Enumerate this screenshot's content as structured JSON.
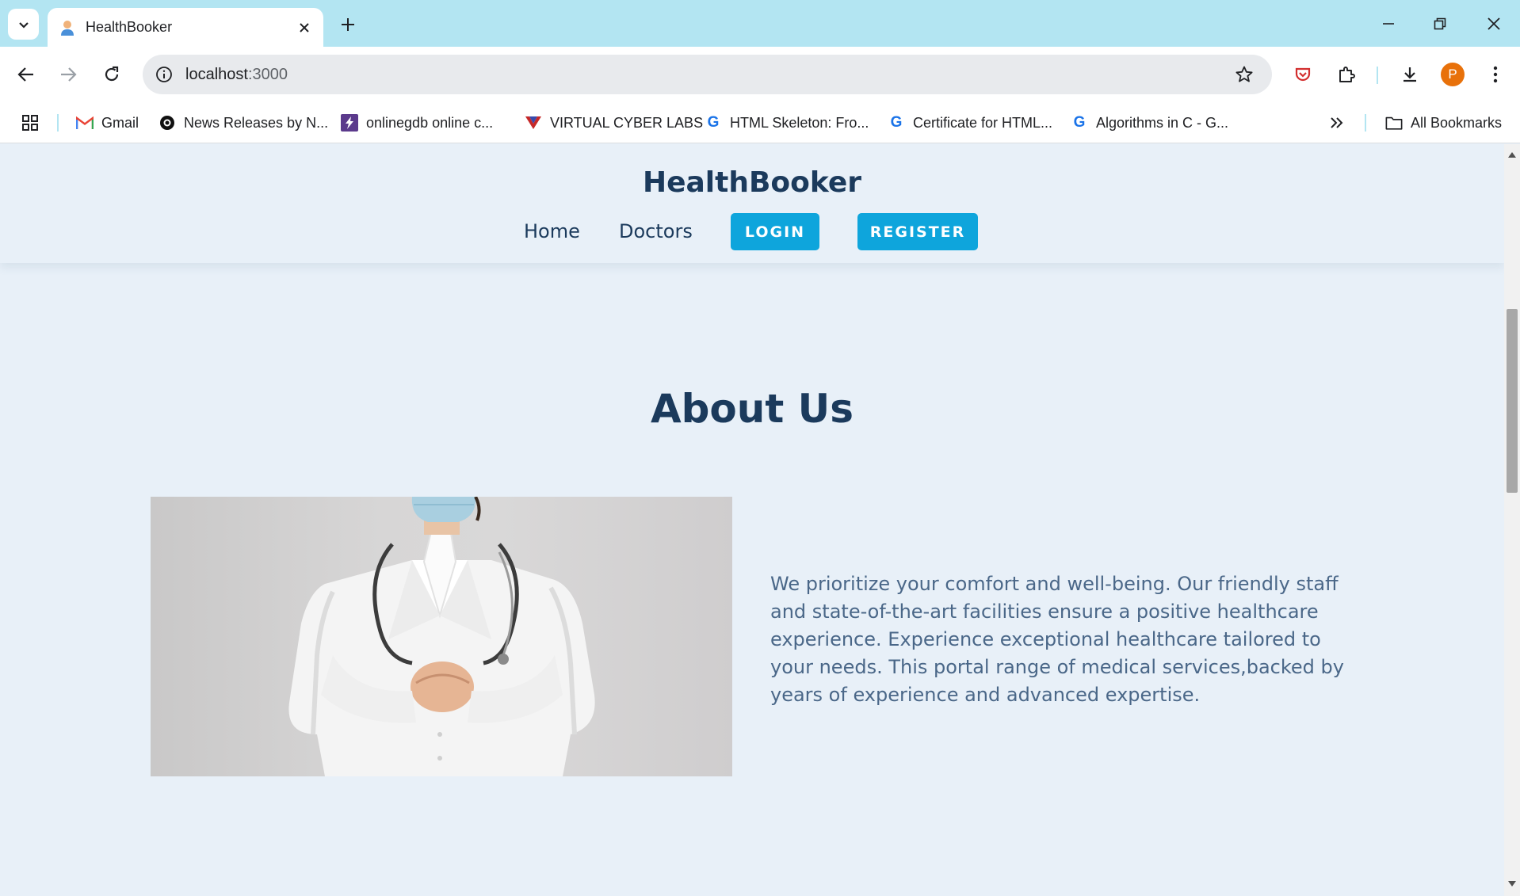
{
  "browser": {
    "tab": {
      "title": "HealthBooker"
    },
    "address_bar": {
      "host": "localhost",
      "port": ":3000"
    },
    "profile_initial": "P",
    "bookmarks": [
      {
        "label": "Gmail",
        "icon": "gmail-icon"
      },
      {
        "label": "News Releases by N...",
        "icon": "record-icon"
      },
      {
        "label": "onlinegdb online c...",
        "icon": "bolt-icon"
      },
      {
        "label": "VIRTUAL CYBER LABS",
        "icon": "v-logo-icon"
      },
      {
        "label": "HTML Skeleton: Fro...",
        "icon": "g-icon"
      },
      {
        "label": "Certificate for HTML...",
        "icon": "g-icon"
      },
      {
        "label": "Algorithms in C - G...",
        "icon": "g-icon"
      }
    ],
    "all_bookmarks_label": "All Bookmarks"
  },
  "site": {
    "brand": "HealthBooker",
    "nav": {
      "home": "Home",
      "doctors": "Doctors",
      "login": "LOGIN",
      "register": "REGISTER"
    }
  },
  "about": {
    "title": "About Us",
    "text": "We prioritize your comfort and well-being. Our friendly staff and state-of-the-art facilities ensure a positive healthcare experience. Experience exceptional healthcare tailored to your needs. This portal range of medical services,backed by years of experience and advanced expertise."
  },
  "colors": {
    "titlebar": "#b3e5f2",
    "page_bg": "#e8f0f8",
    "brand": "#1b3a5c",
    "cta": "#0ea5dc",
    "body_text": "#4a6788"
  }
}
